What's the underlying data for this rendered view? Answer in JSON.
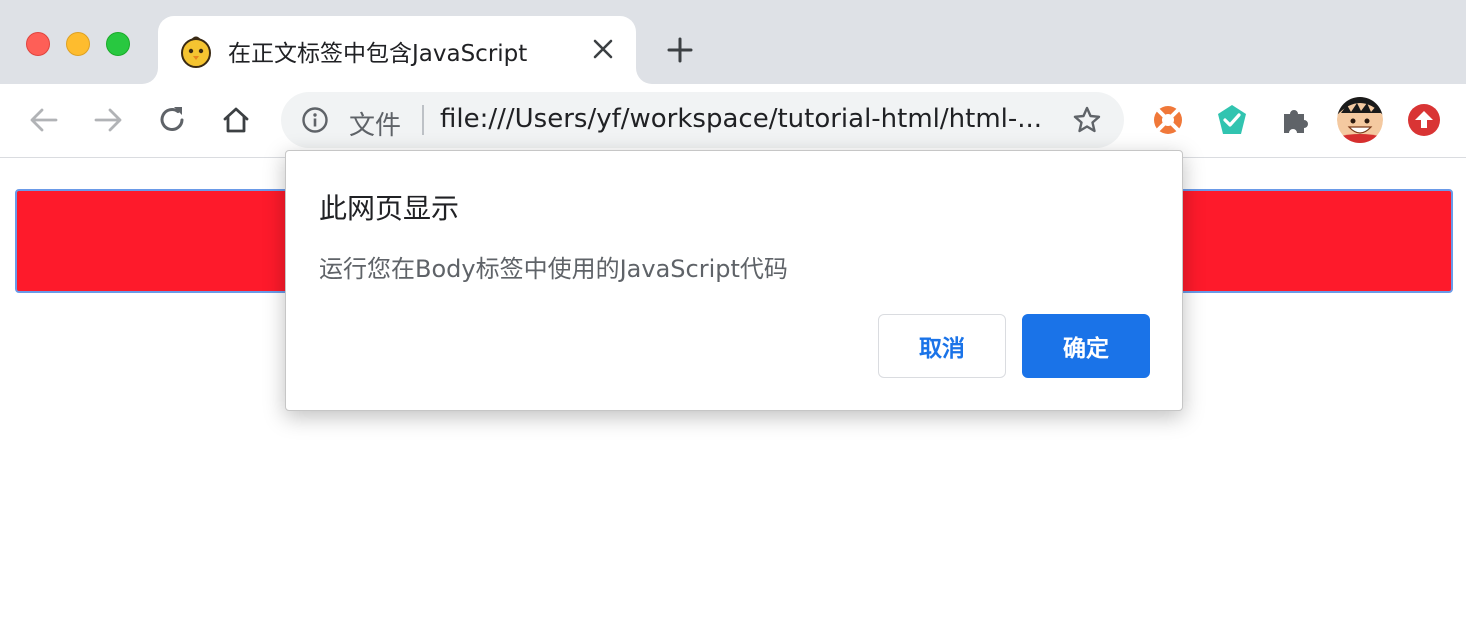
{
  "window": {
    "traffic_lights": [
      "close",
      "minimize",
      "maximize"
    ]
  },
  "tab": {
    "favicon": "chick-favicon-icon",
    "title": "在正文标签中包含JavaScript"
  },
  "toolbar": {
    "buttons": [
      "back-arrow-icon",
      "forward-arrow-icon",
      "reload-icon",
      "home-icon"
    ],
    "omnibox": {
      "chip_label": "文件",
      "url": "file:///Users/yf/workspace/tutorial-html/html-..."
    },
    "extensions": [
      "lifebuoy-icon",
      "check-shield-icon",
      "puzzle-icon",
      "avatar",
      "upload-arrow-icon"
    ]
  },
  "page": {
    "box_color": "#fe1a2b"
  },
  "dialog": {
    "title": "此网页显示",
    "message": "运行您在Body标签中使用的JavaScript代码",
    "cancel_label": "取消",
    "ok_label": "确定",
    "accent_color": "#1a73e8"
  }
}
